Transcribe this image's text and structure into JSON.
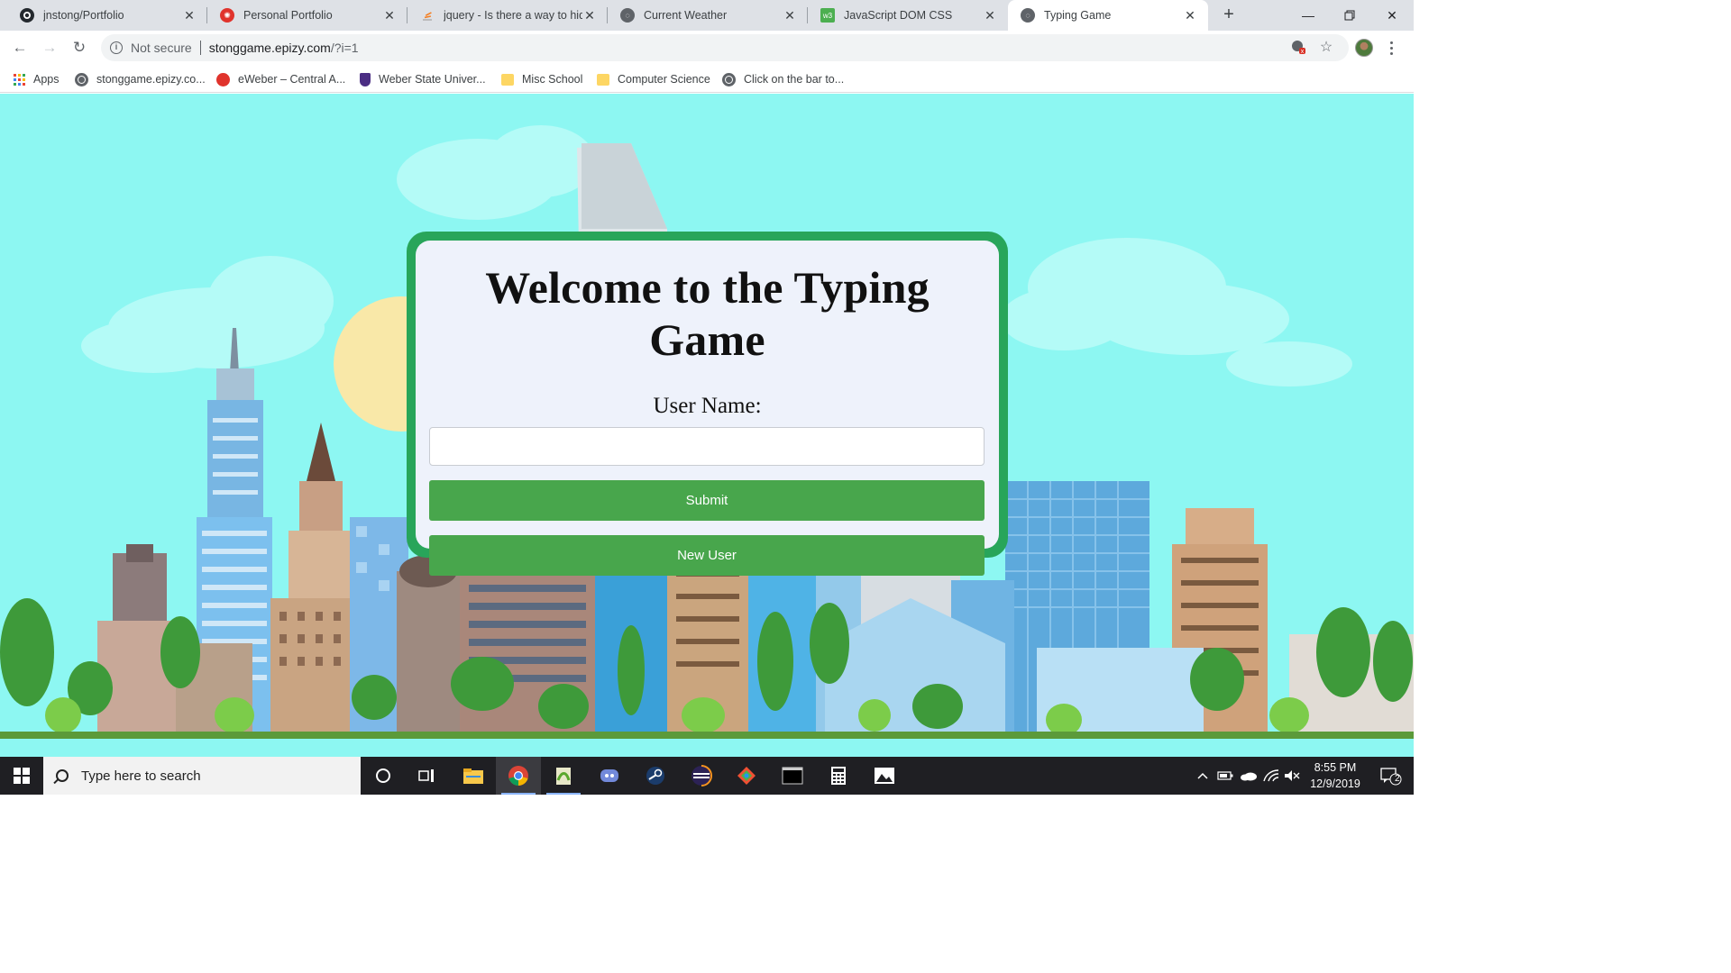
{
  "tabs": [
    {
      "title": "jnstong/Portfolio",
      "icon": "github-icon"
    },
    {
      "title": "Personal Portfolio",
      "icon": "portfolio-icon"
    },
    {
      "title": "jquery - Is there a way to hide",
      "icon": "stackoverflow-icon"
    },
    {
      "title": "Current Weather",
      "icon": "globe-icon"
    },
    {
      "title": "JavaScript DOM CSS",
      "icon": "w3schools-icon"
    },
    {
      "title": "Typing Game",
      "icon": "globe-icon",
      "active": true
    }
  ],
  "address_bar": {
    "security_label": "Not secure",
    "url_host": "stonggame.epizy.com",
    "url_rest": "/?i=1"
  },
  "bookmarks": [
    {
      "label": "Apps",
      "icon": "apps-grid-icon"
    },
    {
      "label": "stonggame.epizy.co...",
      "icon": "globe-icon"
    },
    {
      "label": "eWeber – Central A...",
      "icon": "eweber-icon"
    },
    {
      "label": "Weber State Univer...",
      "icon": "weber-shield-icon"
    },
    {
      "label": "Misc School",
      "icon": "folder-icon"
    },
    {
      "label": "Computer Science",
      "icon": "folder-icon"
    },
    {
      "label": "Click on the bar to...",
      "icon": "globe-icon"
    }
  ],
  "game": {
    "heading": "Welcome to the Typing Game",
    "username_label": "User Name:",
    "username_value": "",
    "submit_label": "Submit",
    "new_user_label": "New User"
  },
  "taskbar": {
    "search_placeholder": "Type here to search",
    "time": "8:55 PM",
    "date": "12/9/2019",
    "notification_count": "2"
  },
  "colors": {
    "card_border": "#28a55a",
    "button": "#48a64c",
    "sky": "#8df7f2"
  }
}
